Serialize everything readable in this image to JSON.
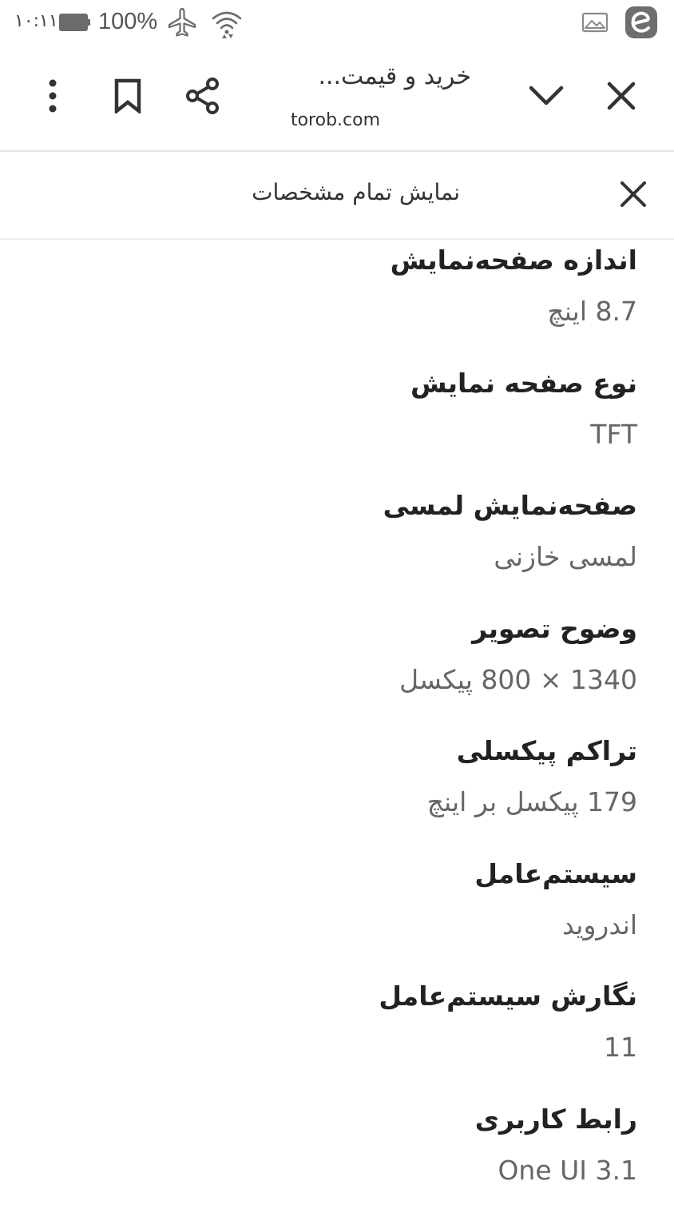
{
  "status_bar": {
    "time": "۱۰:۱۱",
    "battery_percent": "100%",
    "icons": [
      "battery-icon",
      "airplane-mode-icon",
      "wifi-icon",
      "gallery-notification-icon",
      "app-notification-icon"
    ]
  },
  "toolbar": {
    "title": "خرید و قیمت...",
    "url": "torob.com",
    "icons": [
      "more-options-icon",
      "bookmark-icon",
      "share-icon",
      "chevron-down-icon",
      "close-icon"
    ]
  },
  "sheet": {
    "title": "نمایش تمام مشخصات",
    "close_icon": "close-icon"
  },
  "specs": [
    {
      "label": "اندازه صفحه‌نمایش",
      "value": "8.7 اینچ"
    },
    {
      "label": "نوع صفحه نمایش",
      "value": "TFT"
    },
    {
      "label": "صفحه‌نمایش لمسی",
      "value": "لمسی خازنی"
    },
    {
      "label": "وضوح تصویر",
      "value": "1340 × 800 پیکسل"
    },
    {
      "label": "تراکم پیکسلی",
      "value": "179 پیکسل بر اینچ"
    },
    {
      "label": "سیستم‌عامل",
      "value": "اندروید"
    },
    {
      "label": "نگارش سیستم‌عامل",
      "value": "11"
    },
    {
      "label": "رابط کاربری",
      "value": "One UI 3.1"
    }
  ],
  "colors": {
    "text_primary": "#222222",
    "text_secondary": "#666666",
    "divider": "#e3e6e8"
  }
}
